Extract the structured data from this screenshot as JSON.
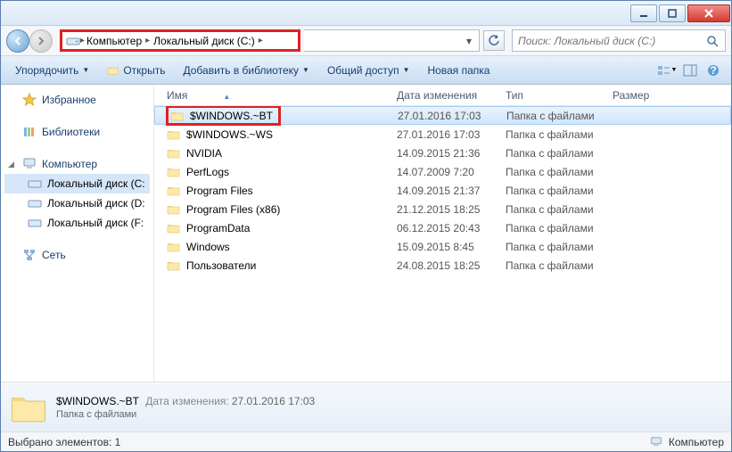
{
  "breadcrumb": {
    "items": [
      "Компьютер",
      "Локальный диск (C:)"
    ]
  },
  "search": {
    "placeholder": "Поиск: Локальный диск (C:)"
  },
  "toolbar": {
    "organize": "Упорядочить",
    "open": "Открыть",
    "add_library": "Добавить в библиотеку",
    "share": "Общий доступ",
    "new_folder": "Новая папка"
  },
  "sidebar": {
    "favorites": "Избранное",
    "libraries": "Библиотеки",
    "computer": "Компьютер",
    "drives": [
      "Локальный диск (C:",
      "Локальный диск (D:",
      "Локальный диск (F:"
    ],
    "network": "Сеть"
  },
  "columns": {
    "name": "Имя",
    "date": "Дата изменения",
    "type": "Тип",
    "size": "Размер"
  },
  "rows": [
    {
      "name": "$WINDOWS.~BT",
      "date": "27.01.2016 17:03",
      "type": "Папка с файлами",
      "selected": true,
      "highlight": true
    },
    {
      "name": "$WINDOWS.~WS",
      "date": "27.01.2016 17:03",
      "type": "Папка с файлами"
    },
    {
      "name": "NVIDIA",
      "date": "14.09.2015 21:36",
      "type": "Папка с файлами"
    },
    {
      "name": "PerfLogs",
      "date": "14.07.2009 7:20",
      "type": "Папка с файлами"
    },
    {
      "name": "Program Files",
      "date": "14.09.2015 21:37",
      "type": "Папка с файлами"
    },
    {
      "name": "Program Files (x86)",
      "date": "21.12.2015 18:25",
      "type": "Папка с файлами"
    },
    {
      "name": "ProgramData",
      "date": "06.12.2015 20:43",
      "type": "Папка с файлами"
    },
    {
      "name": "Windows",
      "date": "15.09.2015 8:45",
      "type": "Папка с файлами"
    },
    {
      "name": "Пользователи",
      "date": "24.08.2015 18:25",
      "type": "Папка с файлами"
    }
  ],
  "details": {
    "name": "$WINDOWS.~BT",
    "date_label": "Дата изменения:",
    "date": "27.01.2016 17:03",
    "type": "Папка с файлами"
  },
  "status": {
    "left": "Выбрано элементов: 1",
    "right": "Компьютер"
  }
}
